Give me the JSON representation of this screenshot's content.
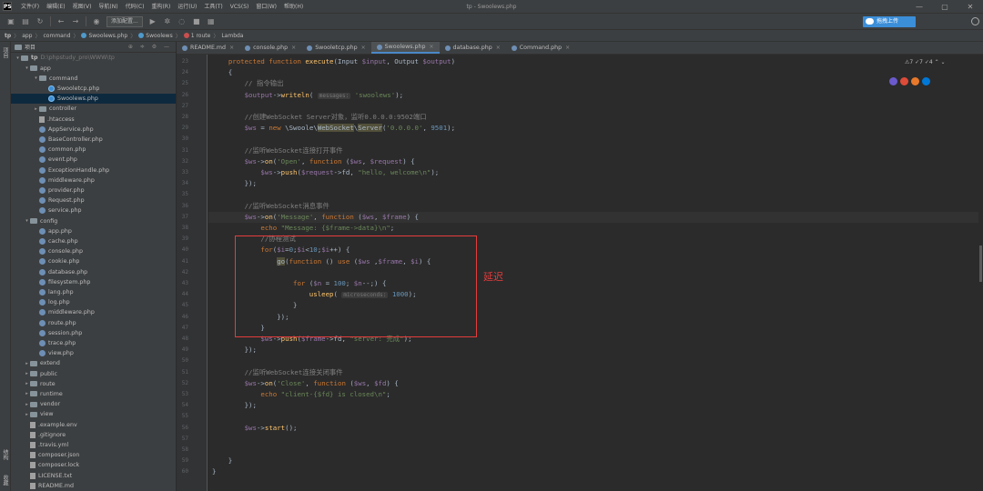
{
  "window": {
    "title": "tp - Swoolews.php"
  },
  "menu": [
    "文件(F)",
    "编辑(E)",
    "视图(V)",
    "导航(N)",
    "代码(C)",
    "重构(R)",
    "运行(U)",
    "工具(T)",
    "VCS(S)",
    "窗口(W)",
    "帮助(H)"
  ],
  "app_logo": "PS",
  "window_controls": [
    "—",
    "▢",
    "✕"
  ],
  "toolbar": {
    "run_config": "添加配置...",
    "upload_label": "拖拽上传"
  },
  "breadcrumb": {
    "items": [
      "tp",
      "app",
      "command",
      "Swoolews.php",
      "Swoolews",
      "1 route",
      "Lambda"
    ],
    "separators": [
      "〉",
      "〉",
      "〉",
      "〉",
      "〉",
      "〉"
    ]
  },
  "left_strip": {
    "top_label": "项目",
    "bottom_labels": [
      "结构",
      "收藏"
    ]
  },
  "project": {
    "header": "项目",
    "header_icons": "⊕ ≑ ⚙ —",
    "items": [
      {
        "depth": 0,
        "arrow": "▾",
        "kind": "folder",
        "name": "tp",
        "path": "D:\\phpstudy_pro\\WWW\\tp"
      },
      {
        "depth": 1,
        "arrow": "▾",
        "kind": "folder",
        "name": "app"
      },
      {
        "depth": 2,
        "arrow": "▾",
        "kind": "folder",
        "name": "command"
      },
      {
        "depth": 3,
        "arrow": "",
        "kind": "swoole",
        "name": "Swooletcp.php"
      },
      {
        "depth": 3,
        "arrow": "",
        "kind": "swoole",
        "name": "Swoolews.php",
        "selected": true
      },
      {
        "depth": 2,
        "arrow": "▸",
        "kind": "folder",
        "name": "controller"
      },
      {
        "depth": 2,
        "arrow": "",
        "kind": "txt",
        "name": ".htaccess"
      },
      {
        "depth": 2,
        "arrow": "",
        "kind": "php",
        "name": "AppService.php"
      },
      {
        "depth": 2,
        "arrow": "",
        "kind": "php",
        "name": "BaseController.php"
      },
      {
        "depth": 2,
        "arrow": "",
        "kind": "php",
        "name": "common.php"
      },
      {
        "depth": 2,
        "arrow": "",
        "kind": "php",
        "name": "event.php"
      },
      {
        "depth": 2,
        "arrow": "",
        "kind": "php",
        "name": "ExceptionHandle.php"
      },
      {
        "depth": 2,
        "arrow": "",
        "kind": "php",
        "name": "middleware.php"
      },
      {
        "depth": 2,
        "arrow": "",
        "kind": "php",
        "name": "provider.php"
      },
      {
        "depth": 2,
        "arrow": "",
        "kind": "php",
        "name": "Request.php"
      },
      {
        "depth": 2,
        "arrow": "",
        "kind": "php",
        "name": "service.php"
      },
      {
        "depth": 1,
        "arrow": "▾",
        "kind": "folder",
        "name": "config"
      },
      {
        "depth": 2,
        "arrow": "",
        "kind": "php",
        "name": "app.php"
      },
      {
        "depth": 2,
        "arrow": "",
        "kind": "php",
        "name": "cache.php"
      },
      {
        "depth": 2,
        "arrow": "",
        "kind": "php",
        "name": "console.php"
      },
      {
        "depth": 2,
        "arrow": "",
        "kind": "php",
        "name": "cookie.php"
      },
      {
        "depth": 2,
        "arrow": "",
        "kind": "php",
        "name": "database.php"
      },
      {
        "depth": 2,
        "arrow": "",
        "kind": "php",
        "name": "filesystem.php"
      },
      {
        "depth": 2,
        "arrow": "",
        "kind": "php",
        "name": "lang.php"
      },
      {
        "depth": 2,
        "arrow": "",
        "kind": "php",
        "name": "log.php"
      },
      {
        "depth": 2,
        "arrow": "",
        "kind": "php",
        "name": "middleware.php"
      },
      {
        "depth": 2,
        "arrow": "",
        "kind": "php",
        "name": "route.php"
      },
      {
        "depth": 2,
        "arrow": "",
        "kind": "php",
        "name": "session.php"
      },
      {
        "depth": 2,
        "arrow": "",
        "kind": "php",
        "name": "trace.php"
      },
      {
        "depth": 2,
        "arrow": "",
        "kind": "php",
        "name": "view.php"
      },
      {
        "depth": 1,
        "arrow": "▸",
        "kind": "folder",
        "name": "extend"
      },
      {
        "depth": 1,
        "arrow": "▸",
        "kind": "folder",
        "name": "public"
      },
      {
        "depth": 1,
        "arrow": "▸",
        "kind": "folder",
        "name": "route"
      },
      {
        "depth": 1,
        "arrow": "▸",
        "kind": "folder",
        "name": "runtime"
      },
      {
        "depth": 1,
        "arrow": "▸",
        "kind": "folder",
        "name": "vendor"
      },
      {
        "depth": 1,
        "arrow": "▸",
        "kind": "folder",
        "name": "view"
      },
      {
        "depth": 1,
        "arrow": "",
        "kind": "txt",
        "name": ".example.env"
      },
      {
        "depth": 1,
        "arrow": "",
        "kind": "txt",
        "name": ".gitignore"
      },
      {
        "depth": 1,
        "arrow": "",
        "kind": "txt",
        "name": ".travis.yml"
      },
      {
        "depth": 1,
        "arrow": "",
        "kind": "txt",
        "name": "composer.json"
      },
      {
        "depth": 1,
        "arrow": "",
        "kind": "txt",
        "name": "composer.lock"
      },
      {
        "depth": 1,
        "arrow": "",
        "kind": "txt",
        "name": "LICENSE.txt"
      },
      {
        "depth": 1,
        "arrow": "",
        "kind": "txt",
        "name": "README.md"
      }
    ]
  },
  "tabs": [
    {
      "label": "README.md",
      "active": false
    },
    {
      "label": "console.php",
      "active": false
    },
    {
      "label": "Swooletcp.php",
      "active": false
    },
    {
      "label": "Swoolews.php",
      "active": true
    },
    {
      "label": "database.php",
      "active": false
    },
    {
      "label": "Command.php",
      "active": false
    }
  ],
  "tab_close": "×",
  "inspections": "⚠7  ✓7  ✓4  ⌃  ⌄",
  "editor": {
    "lines": [
      {
        "n": "23",
        "segs": [
          [
            "    ",
            ""
          ],
          [
            "protected function ",
            "kw"
          ],
          [
            "execute",
            "fn"
          ],
          [
            "(Input ",
            ""
          ],
          [
            "$input",
            "vr"
          ],
          [
            ", Output ",
            ""
          ],
          [
            "$output",
            "vr"
          ],
          [
            ")",
            ""
          ]
        ]
      },
      {
        "n": "24",
        "segs": [
          [
            "    {",
            ""
          ]
        ]
      },
      {
        "n": "25",
        "segs": [
          [
            "        // 指令输出",
            "cm"
          ]
        ]
      },
      {
        "n": "26",
        "segs": [
          [
            "        ",
            ""
          ],
          [
            "$output",
            "vr"
          ],
          [
            "->",
            ""
          ],
          [
            "writeln",
            "fn"
          ],
          [
            "( ",
            ""
          ],
          [
            "messages:",
            "hint"
          ],
          [
            " ",
            ""
          ],
          [
            "'swoolews'",
            "st"
          ],
          [
            ");",
            ""
          ]
        ]
      },
      {
        "n": "27",
        "segs": [
          [
            "",
            ""
          ]
        ]
      },
      {
        "n": "28",
        "segs": [
          [
            "        //创建WebSocket Server对象，监听0.0.0.0:9502端口",
            "cm"
          ]
        ]
      },
      {
        "n": "29",
        "segs": [
          [
            "        ",
            ""
          ],
          [
            "$ws",
            "vr"
          ],
          [
            " = ",
            ""
          ],
          [
            "new ",
            "kw"
          ],
          [
            "\\Swoole\\",
            ""
          ],
          [
            "WebSocket",
            "hl"
          ],
          [
            "\\",
            ""
          ],
          [
            "Server",
            "hl"
          ],
          [
            "(",
            ""
          ],
          [
            "'0.0.0.0'",
            "st"
          ],
          [
            ", ",
            ""
          ],
          [
            "9501",
            "nm"
          ],
          [
            ");",
            ""
          ]
        ]
      },
      {
        "n": "30",
        "segs": [
          [
            "",
            ""
          ]
        ]
      },
      {
        "n": "31",
        "segs": [
          [
            "        //监听WebSocket连接打开事件",
            "cm"
          ]
        ]
      },
      {
        "n": "32",
        "segs": [
          [
            "        ",
            ""
          ],
          [
            "$ws",
            "vr"
          ],
          [
            "->",
            ""
          ],
          [
            "on",
            "fn"
          ],
          [
            "(",
            ""
          ],
          [
            "'Open'",
            "st"
          ],
          [
            ", ",
            ""
          ],
          [
            "function ",
            "kw"
          ],
          [
            "(",
            ""
          ],
          [
            "$ws",
            "vr"
          ],
          [
            ", ",
            ""
          ],
          [
            "$request",
            "vr"
          ],
          [
            ") {",
            ""
          ]
        ]
      },
      {
        "n": "33",
        "segs": [
          [
            "            ",
            ""
          ],
          [
            "$ws",
            "vr"
          ],
          [
            "->",
            ""
          ],
          [
            "push",
            "fn"
          ],
          [
            "(",
            ""
          ],
          [
            "$request",
            "vr"
          ],
          [
            "->fd, ",
            ""
          ],
          [
            "\"hello, welcome\\n\"",
            "st"
          ],
          [
            ");",
            ""
          ]
        ]
      },
      {
        "n": "34",
        "segs": [
          [
            "        });",
            ""
          ]
        ]
      },
      {
        "n": "35",
        "segs": [
          [
            "",
            ""
          ]
        ]
      },
      {
        "n": "36",
        "segs": [
          [
            "        //监听WebSocket消息事件",
            "cm"
          ]
        ]
      },
      {
        "n": "37",
        "cur": true,
        "segs": [
          [
            "        ",
            ""
          ],
          [
            "$ws",
            "vr"
          ],
          [
            "->",
            ""
          ],
          [
            "on",
            "fn"
          ],
          [
            "(",
            ""
          ],
          [
            "'Message'",
            "st"
          ],
          [
            ", ",
            ""
          ],
          [
            "function ",
            "kw"
          ],
          [
            "(",
            ""
          ],
          [
            "$ws",
            "vr"
          ],
          [
            ", ",
            ""
          ],
          [
            "$frame",
            "vr"
          ],
          [
            ") {",
            ""
          ]
        ]
      },
      {
        "n": "38",
        "segs": [
          [
            "            ",
            ""
          ],
          [
            "echo ",
            "kw"
          ],
          [
            "\"Message: {$frame->data}\\n\"",
            "st"
          ],
          [
            ";",
            ""
          ]
        ]
      },
      {
        "n": "39",
        "segs": [
          [
            "            //协程测试",
            "cm"
          ]
        ]
      },
      {
        "n": "40",
        "segs": [
          [
            "            ",
            ""
          ],
          [
            "for",
            "kw"
          ],
          [
            "(",
            ""
          ],
          [
            "$i",
            "vr"
          ],
          [
            "=",
            ""
          ],
          [
            "0",
            "nm"
          ],
          [
            ";",
            ""
          ],
          [
            "$i",
            "vr"
          ],
          [
            "<",
            ""
          ],
          [
            "10",
            "nm"
          ],
          [
            ";",
            ""
          ],
          [
            "$i",
            "vr"
          ],
          [
            "++) {",
            ""
          ]
        ]
      },
      {
        "n": "41",
        "segs": [
          [
            "                ",
            ""
          ],
          [
            "go",
            "hl"
          ],
          [
            "(",
            ""
          ],
          [
            "function ",
            "kw"
          ],
          [
            "() ",
            ""
          ],
          [
            "use ",
            "kw"
          ],
          [
            "(",
            ""
          ],
          [
            "$ws",
            "vr"
          ],
          [
            " ,",
            ""
          ],
          [
            "$frame",
            "vr"
          ],
          [
            ", ",
            ""
          ],
          [
            "$i",
            "vr"
          ],
          [
            ") {",
            ""
          ]
        ]
      },
      {
        "n": "42",
        "segs": [
          [
            "",
            ""
          ]
        ]
      },
      {
        "n": "43",
        "segs": [
          [
            "                    ",
            ""
          ],
          [
            "for ",
            "kw"
          ],
          [
            "(",
            ""
          ],
          [
            "$n",
            "vr"
          ],
          [
            " = ",
            ""
          ],
          [
            "100",
            "nm"
          ],
          [
            "; ",
            ""
          ],
          [
            "$n",
            "vr"
          ],
          [
            "--;) {",
            ""
          ]
        ]
      },
      {
        "n": "44",
        "segs": [
          [
            "                        ",
            ""
          ],
          [
            "usleep",
            "fn"
          ],
          [
            "( ",
            ""
          ],
          [
            "microseconds:",
            "hint"
          ],
          [
            " ",
            ""
          ],
          [
            "1000",
            "nm"
          ],
          [
            ");",
            ""
          ]
        ]
      },
      {
        "n": "45",
        "segs": [
          [
            "                    }",
            ""
          ]
        ]
      },
      {
        "n": "46",
        "segs": [
          [
            "                });",
            ""
          ]
        ]
      },
      {
        "n": "47",
        "segs": [
          [
            "            }",
            ""
          ]
        ]
      },
      {
        "n": "48",
        "segs": [
          [
            "            ",
            ""
          ],
          [
            "$ws",
            "vr"
          ],
          [
            "->",
            ""
          ],
          [
            "push",
            "fn"
          ],
          [
            "(",
            ""
          ],
          [
            "$frame",
            "vr"
          ],
          [
            "->fd, ",
            ""
          ],
          [
            "\"server: 完成\"",
            "st"
          ],
          [
            ");",
            ""
          ]
        ]
      },
      {
        "n": "49",
        "segs": [
          [
            "        });",
            ""
          ]
        ]
      },
      {
        "n": "50",
        "segs": [
          [
            "",
            ""
          ]
        ]
      },
      {
        "n": "51",
        "segs": [
          [
            "        //监听WebSocket连接关闭事件",
            "cm"
          ]
        ]
      },
      {
        "n": "52",
        "segs": [
          [
            "        ",
            ""
          ],
          [
            "$ws",
            "vr"
          ],
          [
            "->",
            ""
          ],
          [
            "on",
            "fn"
          ],
          [
            "(",
            ""
          ],
          [
            "'Close'",
            "st"
          ],
          [
            ", ",
            ""
          ],
          [
            "function ",
            "kw"
          ],
          [
            "(",
            ""
          ],
          [
            "$ws",
            "vr"
          ],
          [
            ", ",
            ""
          ],
          [
            "$fd",
            "vr"
          ],
          [
            ") {",
            ""
          ]
        ]
      },
      {
        "n": "53",
        "segs": [
          [
            "            ",
            ""
          ],
          [
            "echo ",
            "kw"
          ],
          [
            "\"client-{$fd} is closed\\n\"",
            "st"
          ],
          [
            ";",
            ""
          ]
        ]
      },
      {
        "n": "54",
        "segs": [
          [
            "        });",
            ""
          ]
        ]
      },
      {
        "n": "55",
        "segs": [
          [
            "",
            ""
          ]
        ]
      },
      {
        "n": "56",
        "segs": [
          [
            "        ",
            ""
          ],
          [
            "$ws",
            "vr"
          ],
          [
            "->",
            ""
          ],
          [
            "start",
            "fn"
          ],
          [
            "();",
            ""
          ]
        ]
      },
      {
        "n": "57",
        "segs": [
          [
            "",
            ""
          ]
        ]
      },
      {
        "n": "58",
        "segs": [
          [
            "",
            ""
          ]
        ]
      },
      {
        "n": "59",
        "segs": [
          [
            "    }",
            ""
          ]
        ]
      },
      {
        "n": "60",
        "segs": [
          [
            "}",
            ""
          ]
        ]
      }
    ]
  },
  "annotation": {
    "label": "延迟",
    "color": "#e53c3c"
  },
  "colors": {
    "accent": "#4a88c7",
    "upload": "#3b8ed8",
    "highlight_box": "#e53c3c"
  }
}
